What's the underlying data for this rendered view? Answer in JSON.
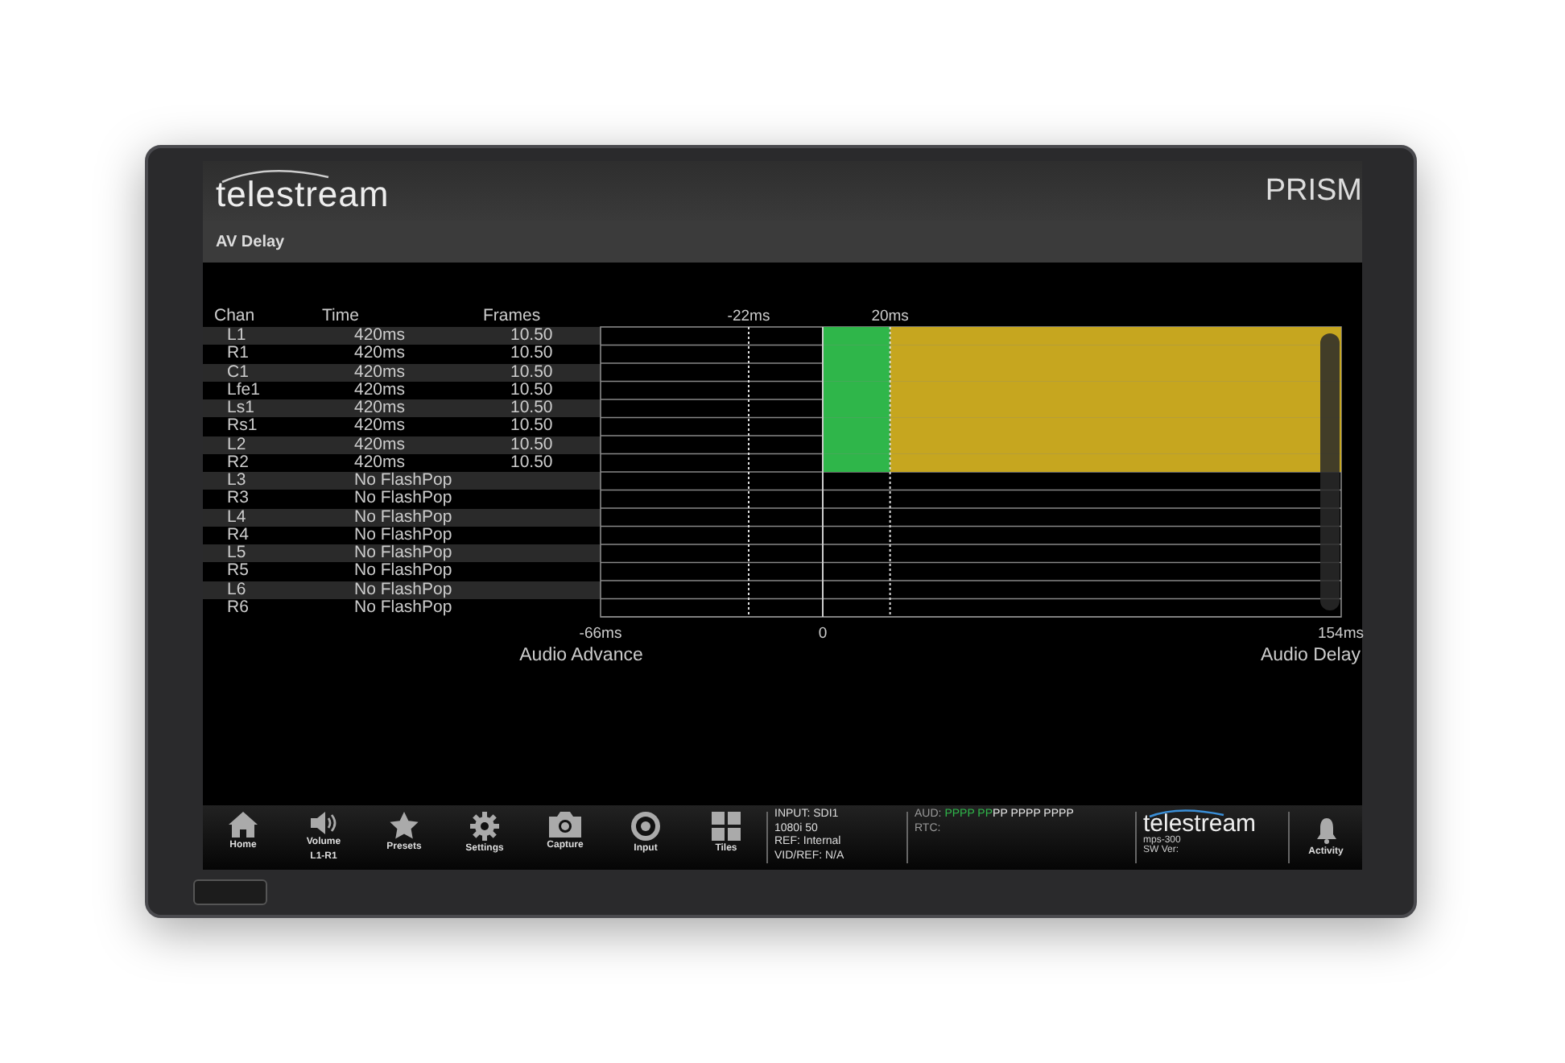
{
  "header": {
    "logo": "telestream",
    "product": "PRISM"
  },
  "panel": {
    "title": "AV Delay"
  },
  "table": {
    "columns": [
      "Chan",
      "Time",
      "Frames"
    ],
    "rows": [
      {
        "chan": "L1",
        "time": "420ms",
        "frames": "10.50"
      },
      {
        "chan": "R1",
        "time": "420ms",
        "frames": "10.50"
      },
      {
        "chan": "C1",
        "time": "420ms",
        "frames": "10.50"
      },
      {
        "chan": "Lfe1",
        "time": "420ms",
        "frames": "10.50"
      },
      {
        "chan": "Ls1",
        "time": "420ms",
        "frames": "10.50"
      },
      {
        "chan": "Rs1",
        "time": "420ms",
        "frames": "10.50"
      },
      {
        "chan": "L2",
        "time": "420ms",
        "frames": "10.50"
      },
      {
        "chan": "R2",
        "time": "420ms",
        "frames": "10.50"
      },
      {
        "chan": "L3",
        "time": "No FlashPop"
      },
      {
        "chan": "R3",
        "time": "No FlashPop"
      },
      {
        "chan": "L4",
        "time": "No FlashPop"
      },
      {
        "chan": "R4",
        "time": "No FlashPop"
      },
      {
        "chan": "L5",
        "time": "No FlashPop"
      },
      {
        "chan": "R5",
        "time": "No FlashPop"
      },
      {
        "chan": "L6",
        "time": "No FlashPop"
      },
      {
        "chan": "R6",
        "time": "No FlashPop"
      }
    ]
  },
  "graph": {
    "markers": [
      "-22ms",
      "20ms"
    ],
    "ticks": [
      "-66ms",
      "0",
      "154ms"
    ],
    "titles": [
      "Audio Advance",
      "Audio Delay"
    ]
  },
  "toolbar": {
    "buttons": [
      {
        "kind": "home",
        "label": "Home"
      },
      {
        "kind": "volume",
        "label": "Volume",
        "sublabel": "L1-R1"
      },
      {
        "kind": "star",
        "label": "Presets"
      },
      {
        "kind": "gear",
        "label": "Settings"
      },
      {
        "kind": "camera",
        "label": "Capture"
      },
      {
        "kind": "input",
        "label": "Input"
      },
      {
        "kind": "tiles",
        "label": "Tiles"
      }
    ],
    "input_lines": [
      "INPUT: SDI1",
      "1080i 50",
      "REF: Internal",
      "VID/REF: N/A"
    ],
    "aud_label": "AUD:",
    "aud_groups": [
      {
        "text": "PPPP PP",
        "color": "#2fb64a"
      },
      {
        "text": "PP PPPP PPPP",
        "color": "#e6e6e6"
      }
    ],
    "rtc_label": "RTC:",
    "logo": "telestream",
    "model": "mps-300",
    "sw_version": "SW Ver:",
    "activity": "Activity"
  }
}
